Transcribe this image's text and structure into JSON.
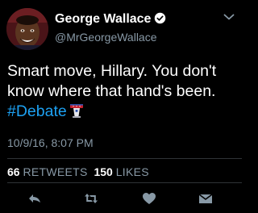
{
  "author": {
    "display_name": "George Wallace",
    "handle": "@MrGeorgeWallace",
    "verified": true
  },
  "tweet": {
    "text_line1": "Smart move, Hillary. You don't",
    "text_line2": "know where that hand's been.",
    "hashtag": "#Debate",
    "hashtag_emoji": "podium-icon",
    "timestamp": "10/9/16, 8:07 PM"
  },
  "stats": {
    "retweets_count": "66",
    "retweets_label": "RETWEETS",
    "likes_count": "150",
    "likes_label": "LIKES"
  },
  "actions": [
    "reply-icon",
    "retweet-icon",
    "like-icon",
    "message-icon"
  ],
  "colors": {
    "background": "#000000",
    "primary_text": "#ffffff",
    "secondary_text": "#8899a6",
    "link": "#1da1f2",
    "verified_badge": "#ffffff",
    "divider": "#2f3336"
  }
}
